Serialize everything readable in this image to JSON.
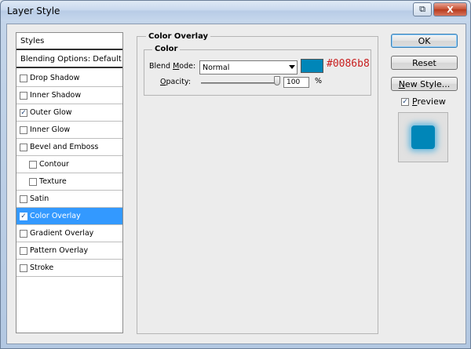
{
  "window": {
    "title": "Layer Style"
  },
  "title_buttons": {
    "help_icon": "layer-style-help-icon",
    "close_label": "X"
  },
  "styles_list": {
    "header": "Styles",
    "blending": "Blending Options: Default",
    "items": [
      {
        "label": "Drop Shadow",
        "checked": false,
        "sub": false,
        "selected": false
      },
      {
        "label": "Inner Shadow",
        "checked": false,
        "sub": false,
        "selected": false
      },
      {
        "label": "Outer Glow",
        "checked": true,
        "sub": false,
        "selected": false
      },
      {
        "label": "Inner Glow",
        "checked": false,
        "sub": false,
        "selected": false
      },
      {
        "label": "Bevel and Emboss",
        "checked": false,
        "sub": false,
        "selected": false
      },
      {
        "label": "Contour",
        "checked": false,
        "sub": true,
        "selected": false
      },
      {
        "label": "Texture",
        "checked": false,
        "sub": true,
        "selected": false
      },
      {
        "label": "Satin",
        "checked": false,
        "sub": false,
        "selected": false
      },
      {
        "label": "Color Overlay",
        "checked": true,
        "sub": false,
        "selected": true
      },
      {
        "label": "Gradient Overlay",
        "checked": false,
        "sub": false,
        "selected": false
      },
      {
        "label": "Pattern Overlay",
        "checked": false,
        "sub": false,
        "selected": false
      },
      {
        "label": "Stroke",
        "checked": false,
        "sub": false,
        "selected": false
      }
    ]
  },
  "color_overlay": {
    "group_title": "Color Overlay",
    "inner_title": "Color",
    "blend_mode_label": "Blend Mode:",
    "blend_mode_label_pre": "Blend ",
    "blend_mode_label_key": "M",
    "blend_mode_label_post": "ode:",
    "blend_mode_value": "Normal",
    "color": "#0086b8",
    "color_hex_text": "#0086b8",
    "opacity_label": "Opacity:",
    "opacity_label_key": "O",
    "opacity_label_post": "pacity:",
    "opacity_value": "100",
    "opacity_percent": 100,
    "opacity_unit": "%"
  },
  "buttons": {
    "ok": "OK",
    "reset": "Reset",
    "new_style_pre": "N",
    "new_style_rest": "ew Style..."
  },
  "preview": {
    "label_pre": "P",
    "label_rest": "review",
    "checked": true
  }
}
